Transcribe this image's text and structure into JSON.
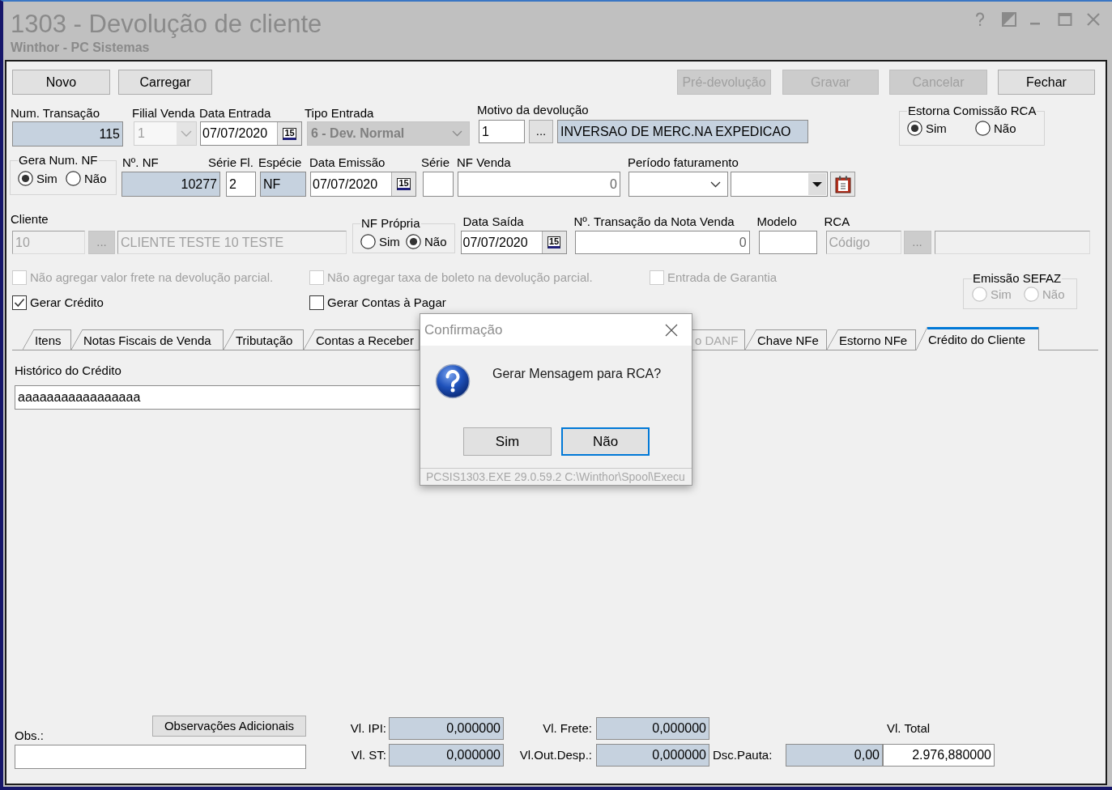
{
  "window": {
    "title": "1303 - Devolução de cliente",
    "subtitle": "Winthor - PC Sistemas"
  },
  "toolbar": {
    "left": [
      {
        "label": "Novo",
        "disabled": false
      },
      {
        "label": "Carregar",
        "disabled": false
      }
    ],
    "right": [
      {
        "label": "Pré-devolução",
        "disabled": true
      },
      {
        "label": "Gravar",
        "disabled": true
      },
      {
        "label": "Cancelar",
        "disabled": true
      },
      {
        "label": "Fechar",
        "disabled": false
      }
    ]
  },
  "header": {
    "num_transacao": {
      "label": "Num. Transação",
      "value": "115",
      "readonly": true
    },
    "filial_venda": {
      "label": "Filial Venda",
      "value": "1",
      "disabled": true
    },
    "data_entrada": {
      "label": "Data Entrada",
      "value": "07/07/2020",
      "calendar_day": "15"
    },
    "tipo_entrada": {
      "label": "Tipo Entrada",
      "value": "6 - Dev. Normal",
      "disabled": true
    },
    "motivo_devolucao": {
      "label": "Motivo da devolução",
      "code": "1",
      "lookup": "...",
      "description": "INVERSAO DE MERC.NA EXPEDICAO",
      "readonly": true
    },
    "estorna_comissao_rca": {
      "label": "Estorna Comissão RCA",
      "disabled": false,
      "options": [
        {
          "label": "Sim",
          "selected": true
        },
        {
          "label": "Não",
          "selected": false
        }
      ]
    }
  },
  "nota": {
    "gera_num_nf": {
      "label": "Gera Num. NF",
      "disabled": false,
      "options": [
        {
          "label": "Sim",
          "selected": true
        },
        {
          "label": "Não",
          "selected": false
        }
      ]
    },
    "num_nf": {
      "label": "Nº. NF",
      "value": "10277",
      "readonly": true
    },
    "serie_fl": {
      "label": "Série Fl.",
      "value": "2"
    },
    "especie": {
      "label": "Espécie",
      "value": "NF",
      "readonly": true
    },
    "data_emissao": {
      "label": "Data Emissão",
      "value": "07/07/2020",
      "calendar_day": "15"
    },
    "serie": {
      "label": "Série"
    },
    "nf_venda": {
      "label": "NF Venda",
      "value": "0"
    },
    "periodo_faturamento": {
      "label": "Período faturamento"
    }
  },
  "cliente": {
    "cliente": {
      "label": "Cliente",
      "code": "10",
      "lookup": "...",
      "name": "CLIENTE TESTE 10 TESTE",
      "disabled": true
    },
    "nf_propria": {
      "label": "NF Própria",
      "disabled": false,
      "options": [
        {
          "label": "Sim",
          "selected": false
        },
        {
          "label": "Não",
          "selected": true
        }
      ]
    },
    "data_saida": {
      "label": "Data Saída",
      "value": "07/07/2020",
      "calendar_day": "15"
    },
    "num_transacao_nota_venda": {
      "label": "Nº. Transação da Nota Venda",
      "value": "0"
    },
    "modelo": {
      "label": "Modelo"
    },
    "rca": {
      "label": "RCA",
      "code": "Código",
      "lookup": "...",
      "disabled": true
    }
  },
  "options": {
    "checkboxes": [
      {
        "label": "Não agregar valor frete na devolução parcial.",
        "checked": false,
        "disabled": true
      },
      {
        "label": "Não agregar taxa de boleto na devolução parcial.",
        "checked": false,
        "disabled": true
      },
      {
        "label": "Entrada de Garantia",
        "checked": false,
        "disabled": true
      },
      {
        "label": "Gerar Crédito",
        "checked": true,
        "disabled": false
      },
      {
        "label": "Gerar Contas à Pagar",
        "checked": false,
        "disabled": false
      }
    ],
    "emissao_sefaz": {
      "label": "Emissão SEFAZ",
      "disabled": true,
      "options": [
        {
          "label": "Sim",
          "selected": false
        },
        {
          "label": "Não",
          "selected": false
        }
      ]
    }
  },
  "tabs": [
    {
      "label": "Itens",
      "selected": false,
      "disabled": false
    },
    {
      "label": "Notas Fiscais de Venda",
      "selected": false,
      "disabled": false
    },
    {
      "label": "Tributação",
      "selected": false,
      "disabled": false
    },
    {
      "label": "Contas a Receber",
      "selected": false,
      "disabled": false
    },
    {
      "label": "o DANF",
      "selected": false,
      "disabled": true
    },
    {
      "label": "Chave NFe",
      "selected": false,
      "disabled": false
    },
    {
      "label": "Estorno NFe",
      "selected": false,
      "disabled": false
    },
    {
      "label": "Crédito do Cliente",
      "selected": true,
      "disabled": false
    }
  ],
  "credito": {
    "historico": {
      "label": "Histórico do Crédito",
      "value": "aaaaaaaaaaaaaaaaa"
    }
  },
  "totals": {
    "obs": {
      "label": "Obs.:"
    },
    "observacoes_button": "Observações Adicionais",
    "vl_ipi": {
      "label": "Vl. IPI:",
      "value": "0,000000",
      "readonly": true
    },
    "vl_frete": {
      "label": "Vl. Frete:",
      "value": "0,000000",
      "readonly": true
    },
    "vl_total": {
      "label": "Vl. Total",
      "value": "2.976,880000"
    },
    "vl_st": {
      "label": "Vl. ST:",
      "value": "0,000000",
      "readonly": true
    },
    "vl_out_desp": {
      "label": "Vl.Out.Desp.:",
      "value": "0,000000",
      "readonly": true
    },
    "dsc_pauta": {
      "label": "Dsc.Pauta:",
      "value": "0,00",
      "readonly": true
    }
  },
  "dialog": {
    "title": "Confirmação",
    "message": "Gerar Mensagem para RCA?",
    "buttons": [
      {
        "label": "Sim",
        "focused": false
      },
      {
        "label": "Não",
        "focused": true
      }
    ],
    "status": "PCSIS1303.EXE 29.0.59.2 C:\\Winthor\\Spool\\Execu"
  }
}
